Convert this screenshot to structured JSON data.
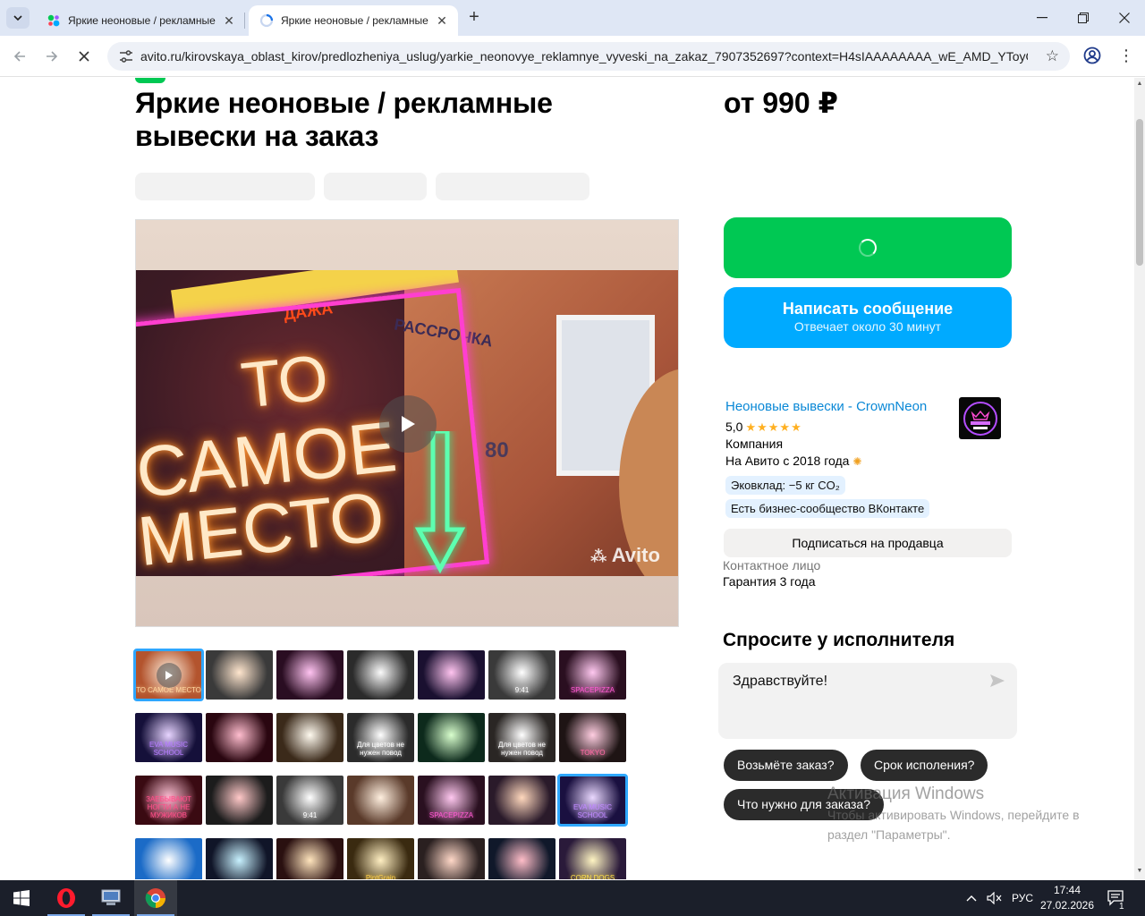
{
  "browser": {
    "tabs": [
      {
        "title": "Яркие неоновые / рекламные",
        "active": false
      },
      {
        "title": "Яркие неоновые / рекламные",
        "active": true
      }
    ],
    "url": "avito.ru/kirovskaya_oblast_kirov/predlozheniya_uslug/yarkie_neonovye_reklamnye_vyveski_na_zakaz_7907352697?context=H4sIAAAAAAAA_wE_AMD_YToyOntz...",
    "new_tab_label": "+"
  },
  "listing": {
    "title": "Яркие неоновые / рекламные вывески на заказ",
    "price": "от 990 ₽",
    "video_watermark": "Avito",
    "video_text": {
      "line1": "ТО",
      "line2": "САМОЕ",
      "line3": "МЕСТО",
      "wall1": "РАССРОЧКА",
      "wall2": "80",
      "wall3": "ДАЖА"
    },
    "thumbnails": [
      {
        "label": "ТО САМОЕ МЕСТО",
        "bg": "#b3542e",
        "fg": "#ffd7a0",
        "selected": true,
        "video": true
      },
      {
        "label": "",
        "bg": "#3a3a3a",
        "fg": "#ffb36b"
      },
      {
        "label": "",
        "bg": "#2a0d22",
        "fg": "#ff4bd5"
      },
      {
        "label": "",
        "bg": "#2b2b2b",
        "fg": "#f2f2f2"
      },
      {
        "label": "",
        "bg": "#1a1030",
        "fg": "#ff4ed1"
      },
      {
        "label": "9:41",
        "bg": "#3a3a3a",
        "fg": "#ffffff"
      },
      {
        "label": "SPACEPIZZA",
        "bg": "#2a0f20",
        "fg": "#ff5ad2"
      },
      {
        "label": "EVA MUSIC SCHOOL",
        "bg": "#15103a",
        "fg": "#b67dff"
      },
      {
        "label": "",
        "bg": "#2a0610",
        "fg": "#ff3a6e"
      },
      {
        "label": "",
        "bg": "#3b2a1a",
        "fg": "#fff0d0"
      },
      {
        "label": "Для цветов не нужен повод",
        "bg": "#2b2b2b",
        "fg": "#ffffff"
      },
      {
        "label": "",
        "bg": "#0d2a1c",
        "fg": "#8cff6b"
      },
      {
        "label": "Для цветов не нужен повод",
        "bg": "#2a2624",
        "fg": "#ffffff"
      },
      {
        "label": "TOKYO",
        "bg": "#1e1414",
        "fg": "#ff6aa5"
      },
      {
        "label": "ЗАЕБЫВАЮТ НОГТИ А НЕ МУЖИКОВ",
        "bg": "#3a0a12",
        "fg": "#ff4f8a"
      },
      {
        "label": "",
        "bg": "#1c1c1c",
        "fg": "#ff5a5a"
      },
      {
        "label": "9:41",
        "bg": "#3a3a3a",
        "fg": "#ffffff"
      },
      {
        "label": "",
        "bg": "#5a3a2a",
        "fg": "#ffd0a0"
      },
      {
        "label": "SPACEPIZZA",
        "bg": "#2a1020",
        "fg": "#ff5ad2"
      },
      {
        "label": "",
        "bg": "#2a1a2a",
        "fg": "#ff8a3a"
      },
      {
        "label": "EVA MUSIC SCHOOL",
        "bg": "#1a1040",
        "fg": "#c08aff",
        "selected": true
      },
      {
        "label": "",
        "bg": "#1b6bc7",
        "fg": "#ffffff"
      },
      {
        "label": "",
        "bg": "#101528",
        "fg": "#5ad7ff"
      },
      {
        "label": "",
        "bg": "#2a1010",
        "fg": "#ffb03a"
      },
      {
        "label": "PintGrain",
        "bg": "#3a2a10",
        "fg": "#ffd04a"
      },
      {
        "label": "",
        "bg": "#2a2020",
        "fg": "#ff8a5a"
      },
      {
        "label": "",
        "bg": "#10182a",
        "fg": "#ff3a5a"
      },
      {
        "label": "CORN DOGS",
        "bg": "#2a1a3a",
        "fg": "#ffe14a"
      }
    ]
  },
  "actions": {
    "message_button": "Написать сообщение",
    "message_sub": "Отвечает около 30 минут"
  },
  "seller": {
    "name": "Неоновые вывески - CrownNeon",
    "rating": "5,0",
    "stars": "★★★★★",
    "type": "Компания",
    "since": "На Авито с 2018 года",
    "badges": [
      "Эковклад: −5 кг CO₂",
      "Есть бизнес-сообщество ВКонтакте"
    ],
    "subscribe_button": "Подписаться на продавца",
    "contact_label": "Контактное лицо",
    "guarantee": "Гарантия 3 года",
    "logo_text": "CROWN NEON"
  },
  "ask": {
    "title": "Спросите у исполнителя",
    "input_value": "Здравствуйте!",
    "chips": [
      "Возьмёте заказ?",
      "Срок исполения?",
      "Что нужно для заказа?"
    ]
  },
  "windows_watermark": {
    "line1": "Активация Windows",
    "line2": "Чтобы активировать Windows, перейдите в",
    "line3": "раздел \"Параметры\"."
  },
  "taskbar": {
    "lang": "РУС",
    "time": "17:44",
    "date": "27.02.2026",
    "notifications": "1"
  },
  "colors": {
    "avito_green": "#00c853",
    "avito_blue": "#00aaff",
    "link_blue": "#0a88d6",
    "star_yellow": "#ffb021"
  }
}
